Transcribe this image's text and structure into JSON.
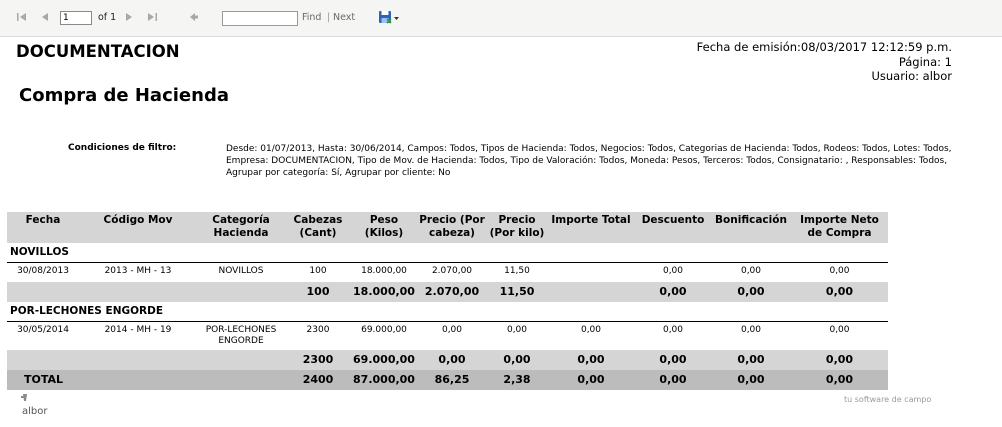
{
  "toolbar": {
    "page_value": "1",
    "of_label": "of 1",
    "find_label": "Find",
    "separator": "|",
    "next_label": "Next"
  },
  "header": {
    "company": "DOCUMENTACION",
    "emission": "Fecha de emisión:08/03/2017 12:12:59 p.m.",
    "page": "Página: 1",
    "user": "Usuario: albor",
    "title": "Compra de Hacienda"
  },
  "filter": {
    "label": "Condiciones de filtro:",
    "text": "Desde: 01/07/2013, Hasta: 30/06/2014, Campos: Todos, Tipos de Hacienda: Todos, Negocios: Todos, Categorias de Hacienda: Todos, Rodeos: Todos, Lotes: Todos, Empresa: DOCUMENTACION, Tipo de Mov. de Hacienda: Todos, Tipo de Valoración: Todos, Moneda: Pesos, Terceros: Todos, Consignatario: , Responsables: Todos, Agrupar por categoría: Sí, Agrupar por cliente: No"
  },
  "table": {
    "columns": [
      {
        "l1": "Fecha",
        "l2": ""
      },
      {
        "l1": "Código Mov",
        "l2": ""
      },
      {
        "l1": "Categoría",
        "l2": "Hacienda"
      },
      {
        "l1": "Cabezas",
        "l2": "(Cant)"
      },
      {
        "l1": "Peso",
        "l2": "(Kilos)"
      },
      {
        "l1": "Precio (Por",
        "l2": "cabeza)"
      },
      {
        "l1": "Precio",
        "l2": "(Por kilo)"
      },
      {
        "l1": "Importe Total",
        "l2": ""
      },
      {
        "l1": "Descuento",
        "l2": ""
      },
      {
        "l1": "Bonificación",
        "l2": ""
      },
      {
        "l1": "Importe Neto",
        "l2": "de Compra"
      }
    ],
    "groups": [
      {
        "name": "NOVILLOS",
        "row": {
          "fecha": "30/08/2013",
          "codigo": "2013 - MH - 13",
          "cat1": "NOVILLOS",
          "cat2": "",
          "cabezas": "100",
          "peso": "18.000,00",
          "precio_cabeza": "2.070,00",
          "precio_kilo": "11,50",
          "importe": "",
          "descuento": "0,00",
          "bonificacion": "0,00",
          "neto": "0,00"
        },
        "subtotal": {
          "cabezas": "100",
          "peso": "18.000,00",
          "precio_cabeza": "2.070,00",
          "precio_kilo": "11,50",
          "importe": "",
          "descuento": "0,00",
          "bonificacion": "0,00",
          "neto": "0,00"
        }
      },
      {
        "name": "POR-LECHONES ENGORDE",
        "row": {
          "fecha": "30/05/2014",
          "codigo": "2014 - MH - 19",
          "cat1": "POR-LECHONES",
          "cat2": "ENGORDE",
          "cabezas": "2300",
          "peso": "69.000,00",
          "precio_cabeza": "0,00",
          "precio_kilo": "0,00",
          "importe": "0,00",
          "descuento": "0,00",
          "bonificacion": "0,00",
          "neto": "0,00"
        },
        "subtotal": {
          "cabezas": "2300",
          "peso": "69.000,00",
          "precio_cabeza": "0,00",
          "precio_kilo": "0,00",
          "importe": "0,00",
          "descuento": "0,00",
          "bonificacion": "0,00",
          "neto": "0,00"
        }
      }
    ],
    "total": {
      "label": "TOTAL",
      "cabezas": "2400",
      "peso": "87.000,00",
      "precio_cabeza": "86,25",
      "precio_kilo": "2,38",
      "importe": "0,00",
      "descuento": "0,00",
      "bonificacion": "0,00",
      "neto": "0,00"
    }
  },
  "footer": {
    "logo_text": "albor",
    "slogan": "tu software de campo"
  },
  "colors": {
    "header_bg": "#d5d5d5",
    "total_bg": "#bcbcbc",
    "toolbar_bg": "#f5f5f3",
    "export_icon": "#2e63b8"
  }
}
